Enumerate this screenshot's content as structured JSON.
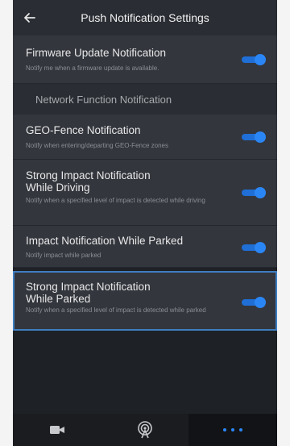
{
  "header": {
    "title": "Push Notification Settings"
  },
  "items": [
    {
      "title": "Firmware Update Notification",
      "desc": "Notify me when a firmware update is available."
    },
    {
      "title": "GEO-Fence Notification",
      "desc": "Notify when entering/departing GEO-Fence zones"
    },
    {
      "title": "Strong Impact Notification\nWhile Driving",
      "desc": "Notify when a specified level of impact is detected while driving"
    },
    {
      "title": "Impact Notification While Parked",
      "desc": "Notify impact while parked"
    },
    {
      "title": "Strong Impact Notification\nWhile Parked",
      "desc": "Notify when a specified level of impact is detected while parked"
    }
  ],
  "section": {
    "label": "Network Function Notification"
  },
  "toggles": {
    "state": "on",
    "accent": "#2b86f5"
  },
  "bottom_nav": {
    "tabs": [
      "video-camera-icon",
      "wifi-broadcast-icon",
      "more-dots-icon"
    ],
    "active": "more-dots-icon"
  },
  "colors": {
    "background": "#1e2126",
    "item": "#33363d",
    "selection_border": "#3f7ec2"
  }
}
